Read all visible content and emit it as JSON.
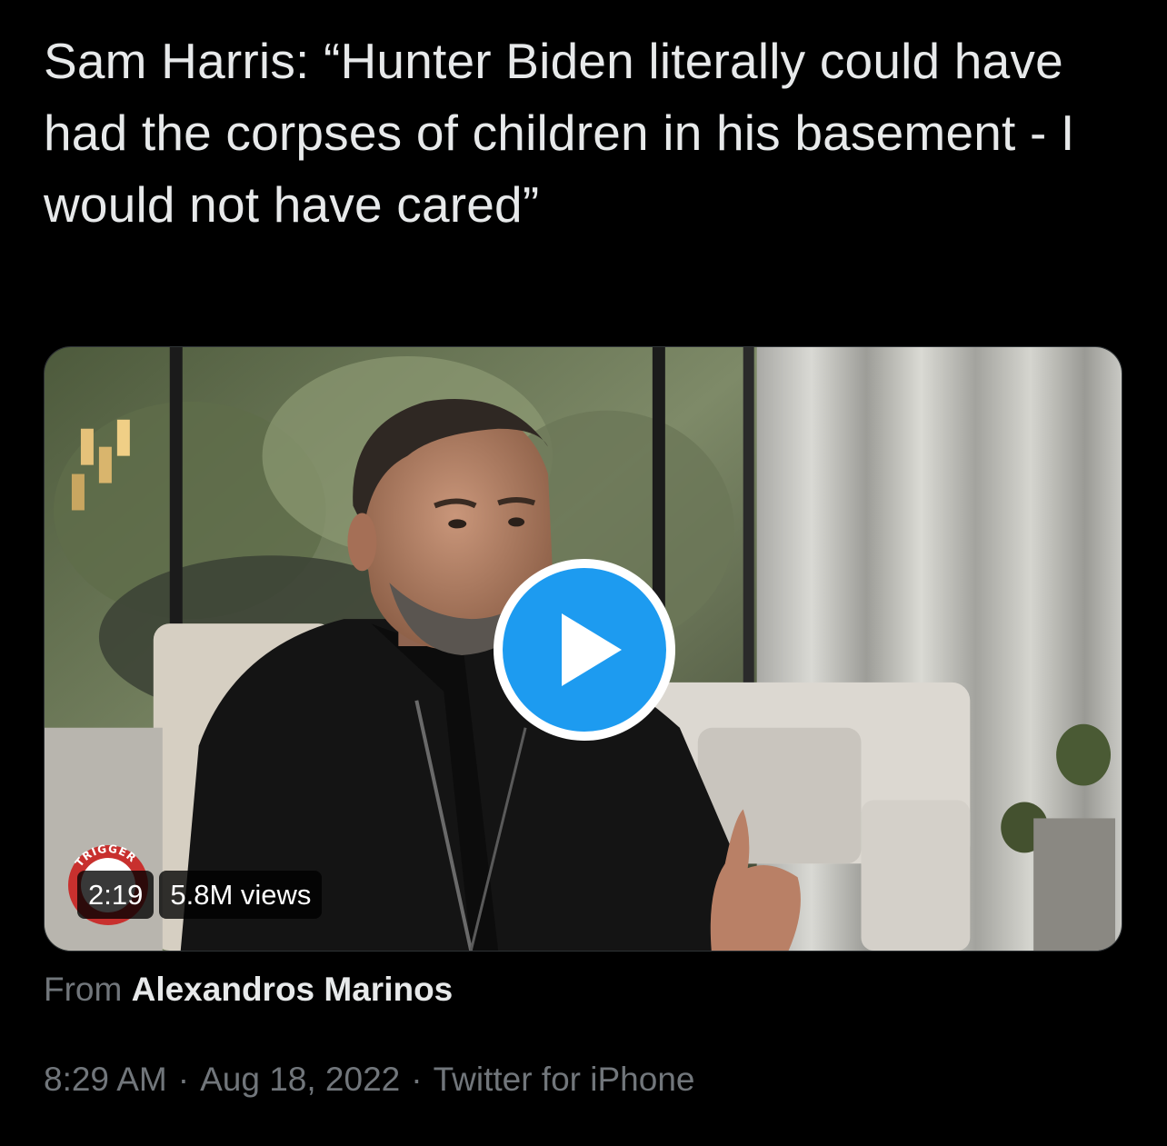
{
  "tweet": {
    "text": "Sam Harris: “Hunter Biden literally could have had the corpses of children in his basement - I would not have cared”"
  },
  "video": {
    "duration": "2:19",
    "views": "5.8M views",
    "play_icon": "play-icon",
    "logo_text": "TRIGGER",
    "play_color": "#1d9bf0"
  },
  "source": {
    "prefix": "From",
    "author": "Alexandros Marinos"
  },
  "meta": {
    "time": "8:29 AM",
    "separator": "·",
    "date": "Aug 18, 2022",
    "client": "Twitter for iPhone"
  }
}
